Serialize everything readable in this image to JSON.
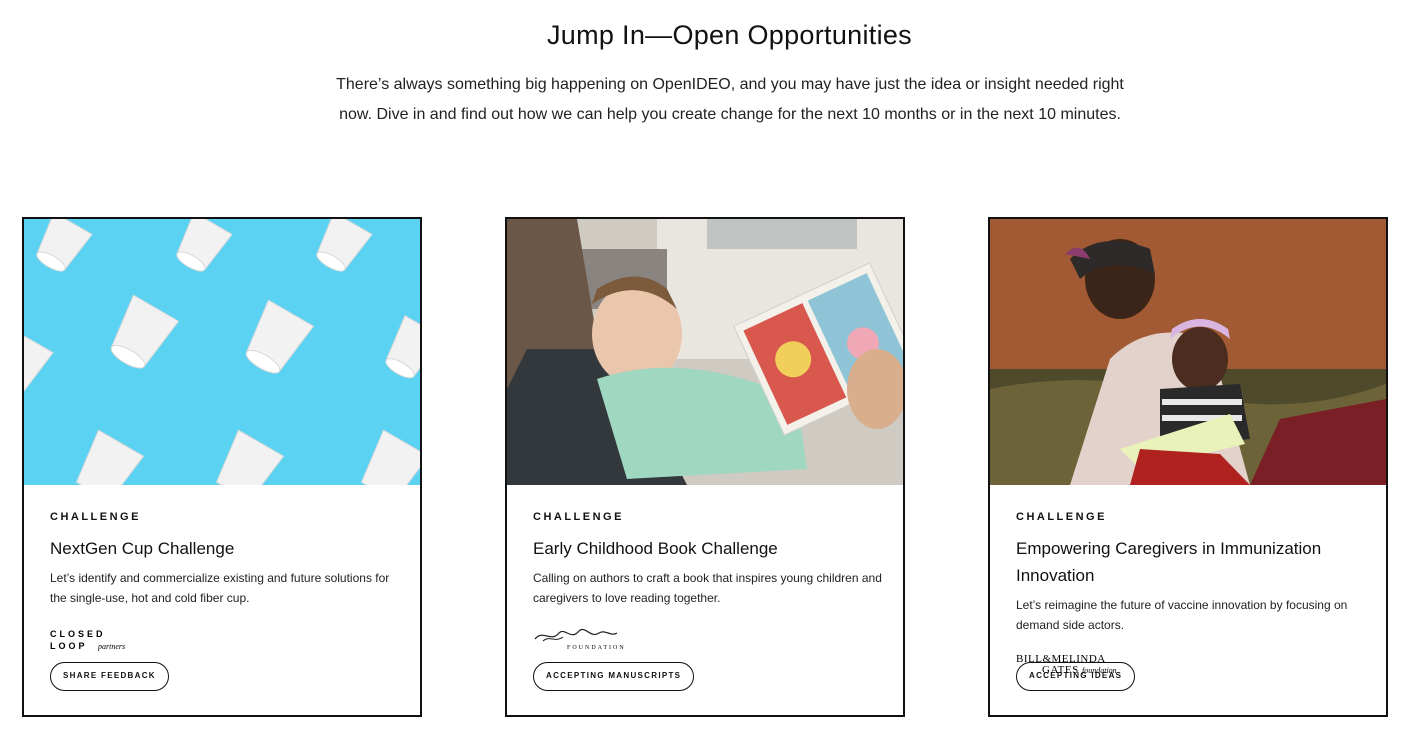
{
  "section": {
    "heading": "Jump In—Open Opportunities",
    "intro": "There’s always something big happening on OpenIDEO, and you may have just the idea or insight needed right now. Dive in and find out how we can help you create change for the next 10 months or in the next 10 minutes."
  },
  "cards": [
    {
      "kicker": "CHALLENGE",
      "title": "NextGen Cup Challenge",
      "description": "Let’s identify and commercialize existing and future solutions for the single-use, hot and cold fiber cup.",
      "sponsor_logo": "CLOSED LOOP partners",
      "cta": "SHARE FEEDBACK"
    },
    {
      "kicker": "CHALLENGE",
      "title": "Early Childhood Book Challenge",
      "description": "Calling on authors to craft a book that inspires young children and caregivers to love reading together.",
      "sponsor_logo": "W.K. Kellogg Foundation",
      "cta": "ACCEPTING MANUSCRIPTS"
    },
    {
      "kicker": "CHALLENGE",
      "title": "Empowering Caregivers in Immunization Innovation",
      "description": "Let’s reimagine the future of vaccine innovation by focusing on demand side actors.",
      "sponsor_logo": "BILL & MELINDA GATES foundation",
      "cta": "ACCEPTING IDEAS"
    }
  ],
  "colors": {
    "cup_background": "#5fd3f3",
    "border": "#111111"
  }
}
